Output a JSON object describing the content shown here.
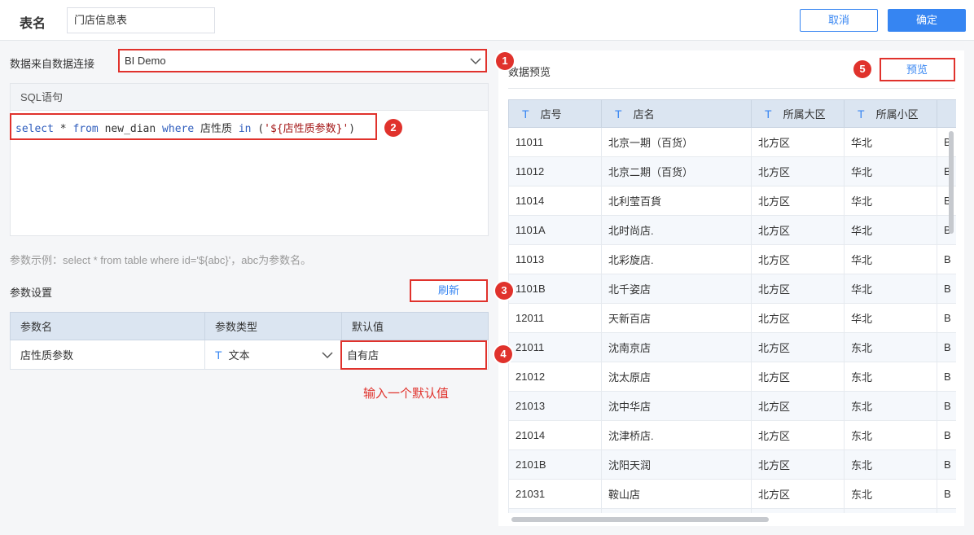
{
  "header": {
    "title": "表名",
    "table_name_value": "门店信息表",
    "cancel_label": "取消",
    "confirm_label": "确定"
  },
  "left": {
    "conn_label": "数据来自数据连接",
    "conn_value": "BI Demo",
    "sql_header": "SQL语句",
    "sql": {
      "kw_select": "select",
      "t1": " * ",
      "kw_from": "from",
      "t2": " new_dian ",
      "kw_where": "where",
      "t3": " 店性质 ",
      "kw_in": "in",
      "t4": " (",
      "literal": "'${店性质参数}'",
      "t5": ")"
    },
    "hint": "参数示例：select * from table where id='${abc}'，abc为参数名。",
    "param_settings_label": "参数设置",
    "refresh_label": "刷新",
    "param_table": {
      "headers": [
        "参数名",
        "参数类型",
        "默认值"
      ],
      "row": {
        "name": "店性质参数",
        "type_icon": "T",
        "type": "文本",
        "default": "自有店"
      }
    },
    "annotation_text": "输入一个默认值"
  },
  "right": {
    "title": "数据预览",
    "preview_label": "预览",
    "columns": [
      "店号",
      "店名",
      "所属大区",
      "所属小区"
    ],
    "column_icon": "T",
    "rows": [
      [
        "11011",
        "北京一期（百货）",
        "北方区",
        "华北",
        "B"
      ],
      [
        "11012",
        "北京二期（百货）",
        "北方区",
        "华北",
        "B"
      ],
      [
        "11014",
        "北利莹百貨",
        "北方区",
        "华北",
        "B"
      ],
      [
        "1101A",
        "北时尚店.",
        "北方区",
        "华北",
        "B"
      ],
      [
        "11013",
        "北彩旋店.",
        "北方区",
        "华北",
        "B"
      ],
      [
        "1101B",
        "北千姿店",
        "北方区",
        "华北",
        "B"
      ],
      [
        "12011",
        "天新百店",
        "北方区",
        "华北",
        "B"
      ],
      [
        "21011",
        "沈南京店",
        "北方区",
        "东北",
        "B"
      ],
      [
        "21012",
        "沈太原店",
        "北方区",
        "东北",
        "B"
      ],
      [
        "21013",
        "沈中华店",
        "北方区",
        "东北",
        "B"
      ],
      [
        "21014",
        "沈津桥店.",
        "北方区",
        "东北",
        "B"
      ],
      [
        "2101B",
        "沈阳天润",
        "北方区",
        "东北",
        "B"
      ],
      [
        "21031",
        "鞍山店",
        "北方区",
        "东北",
        "B"
      ],
      [
        "",
        "",
        "",
        "",
        ""
      ]
    ]
  },
  "badges": [
    "1",
    "2",
    "3",
    "4",
    "5"
  ],
  "colors": {
    "accent": "#3685f2",
    "annotation": "#e0322c",
    "header_bg": "#dbe5f1"
  }
}
